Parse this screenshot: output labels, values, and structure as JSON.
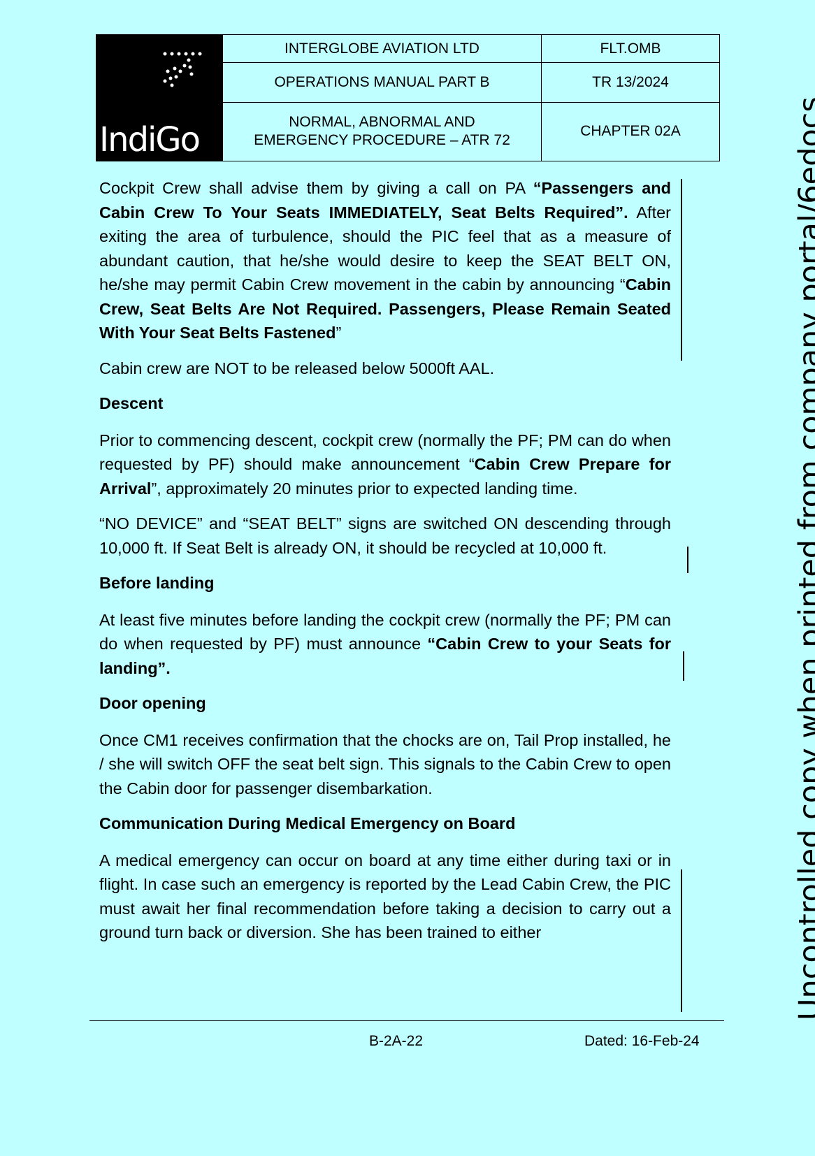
{
  "header": {
    "logo_text": "IndiGo",
    "company": "INTERGLOBE AVIATION LTD",
    "doc_code": "FLT.OMB",
    "manual": "OPERATIONS MANUAL PART B",
    "revision": "TR 13/2024",
    "title_line1": "NORMAL, ABNORMAL AND",
    "title_line2": "EMERGENCY PROCEDURE – ATR 72",
    "chapter": "CHAPTER  02A"
  },
  "body": {
    "p1_a": "Cockpit Crew shall advise them by giving a call on PA ",
    "p1_b": "“Passengers and Cabin Crew To Your Seats IMMEDIATELY, Seat Belts Required”.",
    "p1_c": " After exiting the area of turbulence, should the PIC feel that as a measure of abundant caution, that he/she would desire to keep the SEAT BELT ON, he/she may permit Cabin Crew movement in the cabin by announcing “",
    "p1_d": "Cabin Crew, Seat Belts Are Not Required. Passengers, Please Remain Seated With Your Seat Belts Fastened",
    "p1_e": "”",
    "p2": "Cabin crew are NOT to be released below 5000ft AAL.",
    "h_descent": "Descent",
    "p3_a": "Prior to commencing descent, cockpit crew (normally the PF; PM can do when requested by PF) should make announcement “",
    "p3_b": "Cabin Crew Prepare for Arrival",
    "p3_c": "”, approximately 20 minutes prior to expected landing time.",
    "p4": "“NO DEVICE” and “SEAT BELT” signs are switched ON descending through 10,000 ft. If Seat Belt is already ON, it should be recycled at 10,000 ft.",
    "h_before_landing": "Before landing",
    "p5_a": "At least five minutes before landing the cockpit crew (normally the PF; PM can do when requested by PF) must announce ",
    "p5_b": "“Cabin Crew to your Seats for landing”.",
    "h_door": "Door opening",
    "p6": "Once CM1 receives confirmation that the chocks are on, Tail Prop installed, he / she will switch OFF the seat belt sign. This signals to the Cabin Crew to open the Cabin door for passenger disembarkation.",
    "h_medical": "Communication During Medical Emergency on Board",
    "p7": "A medical emergency can occur on board at any time either during taxi or in flight. In case such an emergency is reported by the Lead Cabin Crew, the PIC must await her final recommendation before taking a decision to carry out a ground turn back or diversion. She has been trained to either"
  },
  "footer": {
    "page": "B-2A-22",
    "date": "Dated: 16-Feb-24"
  },
  "watermark": "Uncontrolled copy when printed from company portal/6edocs",
  "colors": {
    "page_background": "#bfffff",
    "logo_background": "#000000"
  }
}
